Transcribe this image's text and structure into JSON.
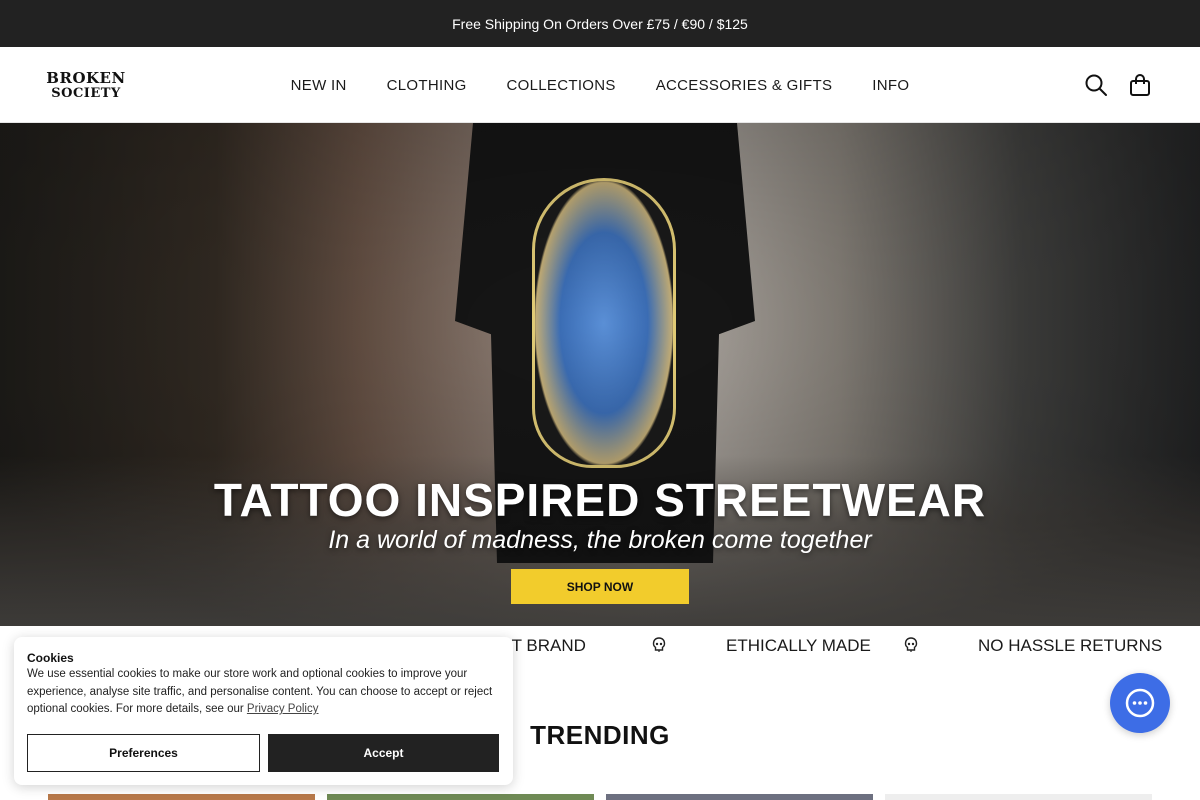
{
  "announcement": "Free Shipping On Orders Over £75 / €90 / $125",
  "logo": {
    "line1": "BROKEN",
    "line2": "SOCIETY"
  },
  "nav": [
    "NEW IN",
    "CLOTHING",
    "COLLECTIONS",
    "ACCESSORIES & GIFTS",
    "INFO"
  ],
  "header_icons": [
    "search-icon",
    "bag-icon"
  ],
  "hero": {
    "title": "TATTOO INSPIRED STREETWEAR",
    "subtitle": "In a world of madness, the broken come together",
    "cta": "SHOP NOW",
    "cta_color": "#f2cc2c"
  },
  "usps": [
    "ENT BRAND",
    "ETHICALLY MADE",
    "NO HASSLE RETURNS"
  ],
  "section_title": "TRENDING",
  "cookie": {
    "title": "Cookies",
    "text": "We use essential cookies to make our store work and optional cookies to improve your experience, analyse site traffic, and personalise content. You can choose to accept or reject optional cookies. For more details, see our",
    "link": "Privacy Policy",
    "preferences": "Preferences",
    "accept": "Accept"
  },
  "colors": {
    "dark": "#222222",
    "accent": "#f2cc2c",
    "chat": "#3d6de6"
  }
}
